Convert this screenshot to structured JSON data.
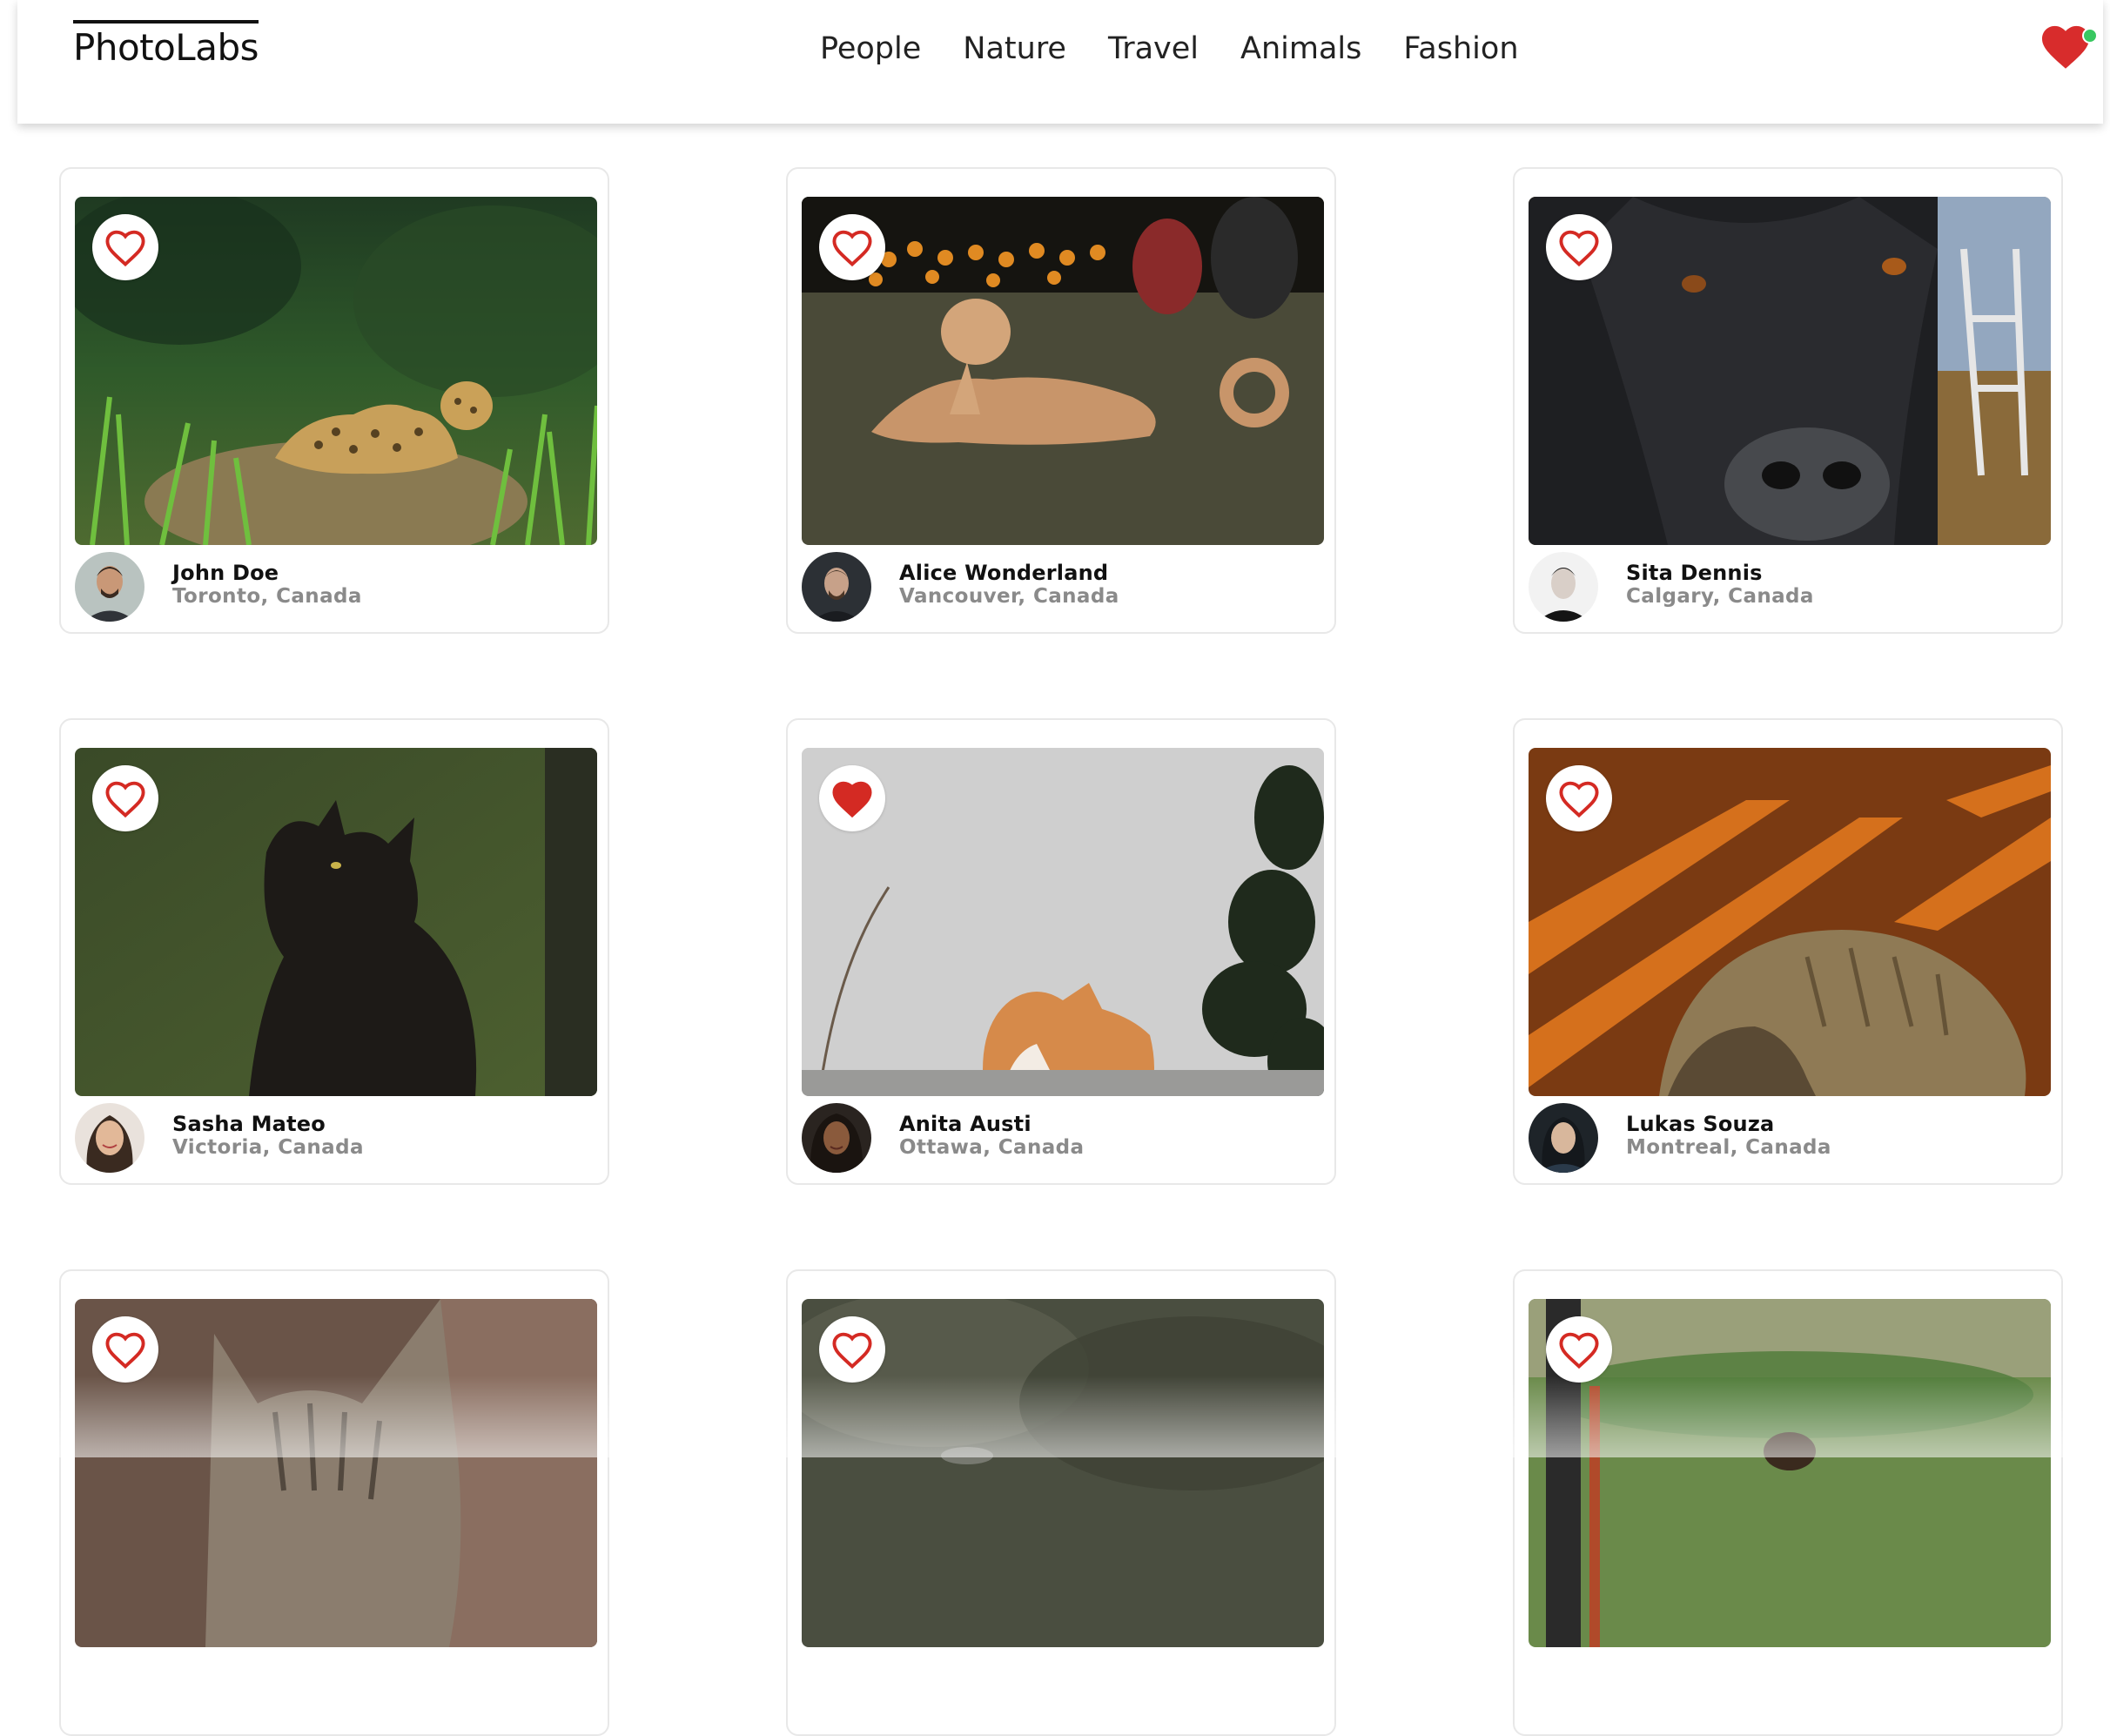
{
  "app": {
    "logo": "PhotoLabs",
    "topics": [
      "People",
      "Nature",
      "Travel",
      "Animals",
      "Fashion"
    ],
    "favorites_badge": {
      "icon": "heart-icon",
      "has_notification": true,
      "color": "#D82C2C",
      "dot_color": "#38C760"
    }
  },
  "photos": [
    {
      "user": "John Doe",
      "location": "Toronto, Canada",
      "liked": false,
      "subject": "jaguar"
    },
    {
      "user": "Alice Wonderland",
      "location": "Vancouver, Canada",
      "liked": false,
      "subject": "dog"
    },
    {
      "user": "Sita Dennis",
      "location": "Calgary, Canada",
      "liked": false,
      "subject": "dog-closeup"
    },
    {
      "user": "Sasha Mateo",
      "location": "Victoria, Canada",
      "liked": false,
      "subject": "black-cat"
    },
    {
      "user": "Anita Austi",
      "location": "Ottawa, Canada",
      "liked": true,
      "subject": "orange-cat"
    },
    {
      "user": "Lukas Souza",
      "location": "Montreal, Canada",
      "liked": false,
      "subject": "sleeping-cat"
    },
    {
      "user": "",
      "location": "",
      "liked": false,
      "subject": "tabby-cat"
    },
    {
      "user": "",
      "location": "",
      "liked": false,
      "subject": "blurred-animal"
    },
    {
      "user": "",
      "location": "",
      "liked": false,
      "subject": "dog-on-grass"
    }
  ],
  "colors": {
    "like_red": "#D42A23",
    "card_border": "#E8E8E8",
    "location_gray": "#8A8A8A"
  }
}
